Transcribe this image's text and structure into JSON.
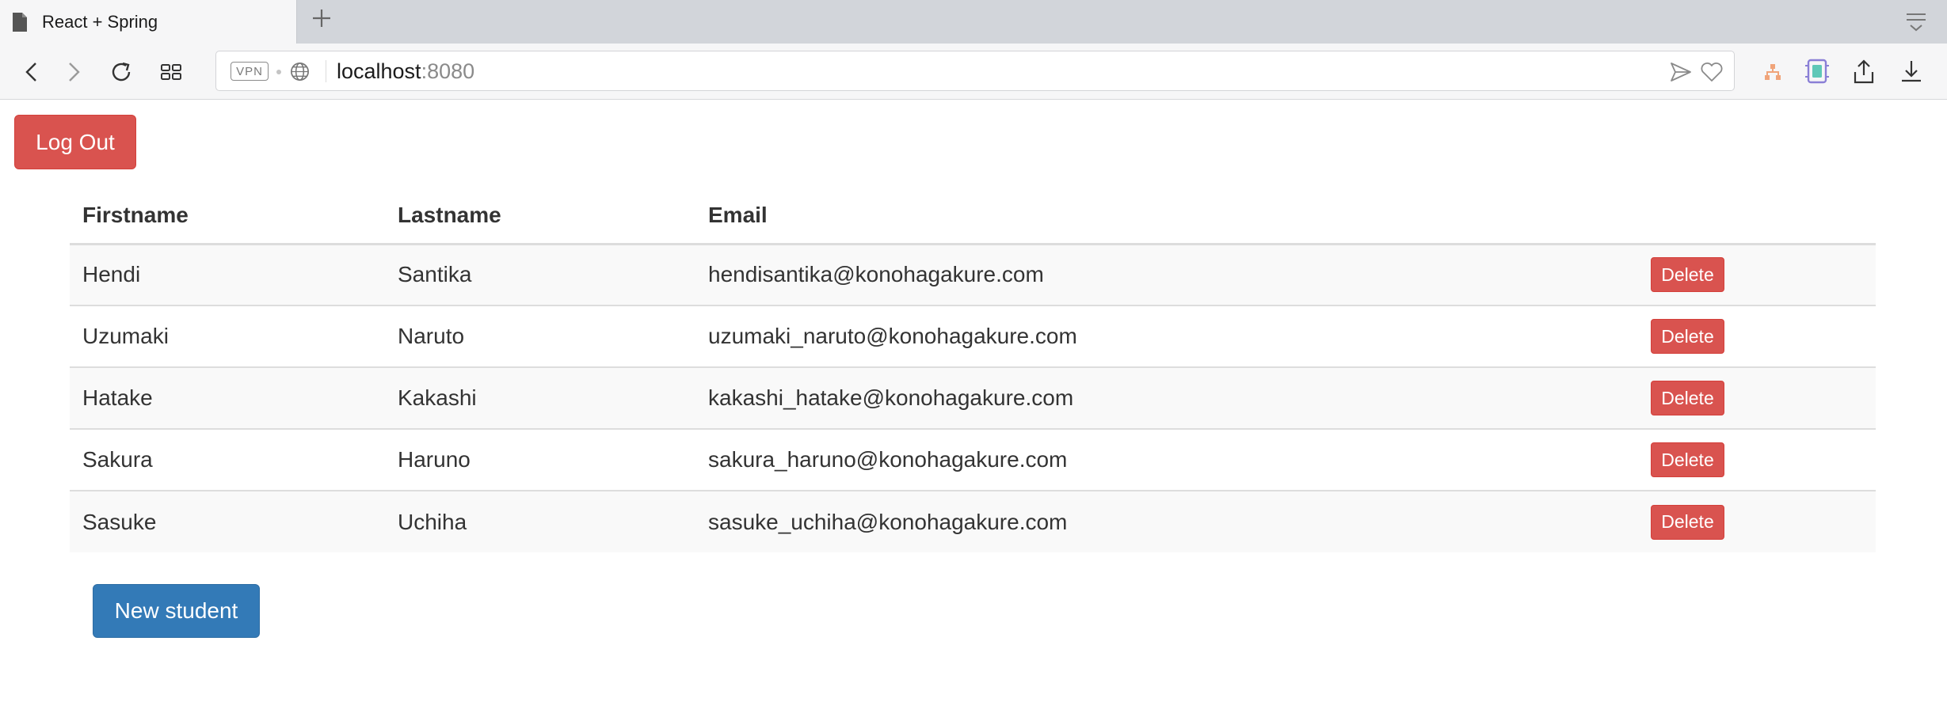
{
  "browser": {
    "tab_title": "React + Spring",
    "url_host": "localhost",
    "url_port": ":8080",
    "vpn_label": "VPN"
  },
  "page": {
    "logout_label": "Log Out",
    "new_student_label": "New student",
    "delete_label": "Delete",
    "columns": [
      "Firstname",
      "Lastname",
      "Email"
    ],
    "students": [
      {
        "firstname": "Hendi",
        "lastname": "Santika",
        "email": "hendisantika@konohagakure.com"
      },
      {
        "firstname": "Uzumaki",
        "lastname": "Naruto",
        "email": "uzumaki_naruto@konohagakure.com"
      },
      {
        "firstname": "Hatake",
        "lastname": "Kakashi",
        "email": "kakashi_hatake@konohagakure.com"
      },
      {
        "firstname": "Sakura",
        "lastname": "Haruno",
        "email": "sakura_haruno@konohagakure.com"
      },
      {
        "firstname": "Sasuke",
        "lastname": "Uchiha",
        "email": "sasuke_uchiha@konohagakure.com"
      }
    ]
  },
  "colors": {
    "danger": "#d9534f",
    "primary": "#337ab7",
    "row_stripe": "#f9f9f9"
  },
  "icons": [
    "document-icon",
    "plus-icon",
    "tab-menu-icon",
    "back-icon",
    "forward-icon",
    "reload-icon",
    "speed-dial-icon",
    "globe-icon",
    "send-icon",
    "heart-icon",
    "network-icon",
    "extension-icon",
    "share-icon",
    "download-icon"
  ]
}
